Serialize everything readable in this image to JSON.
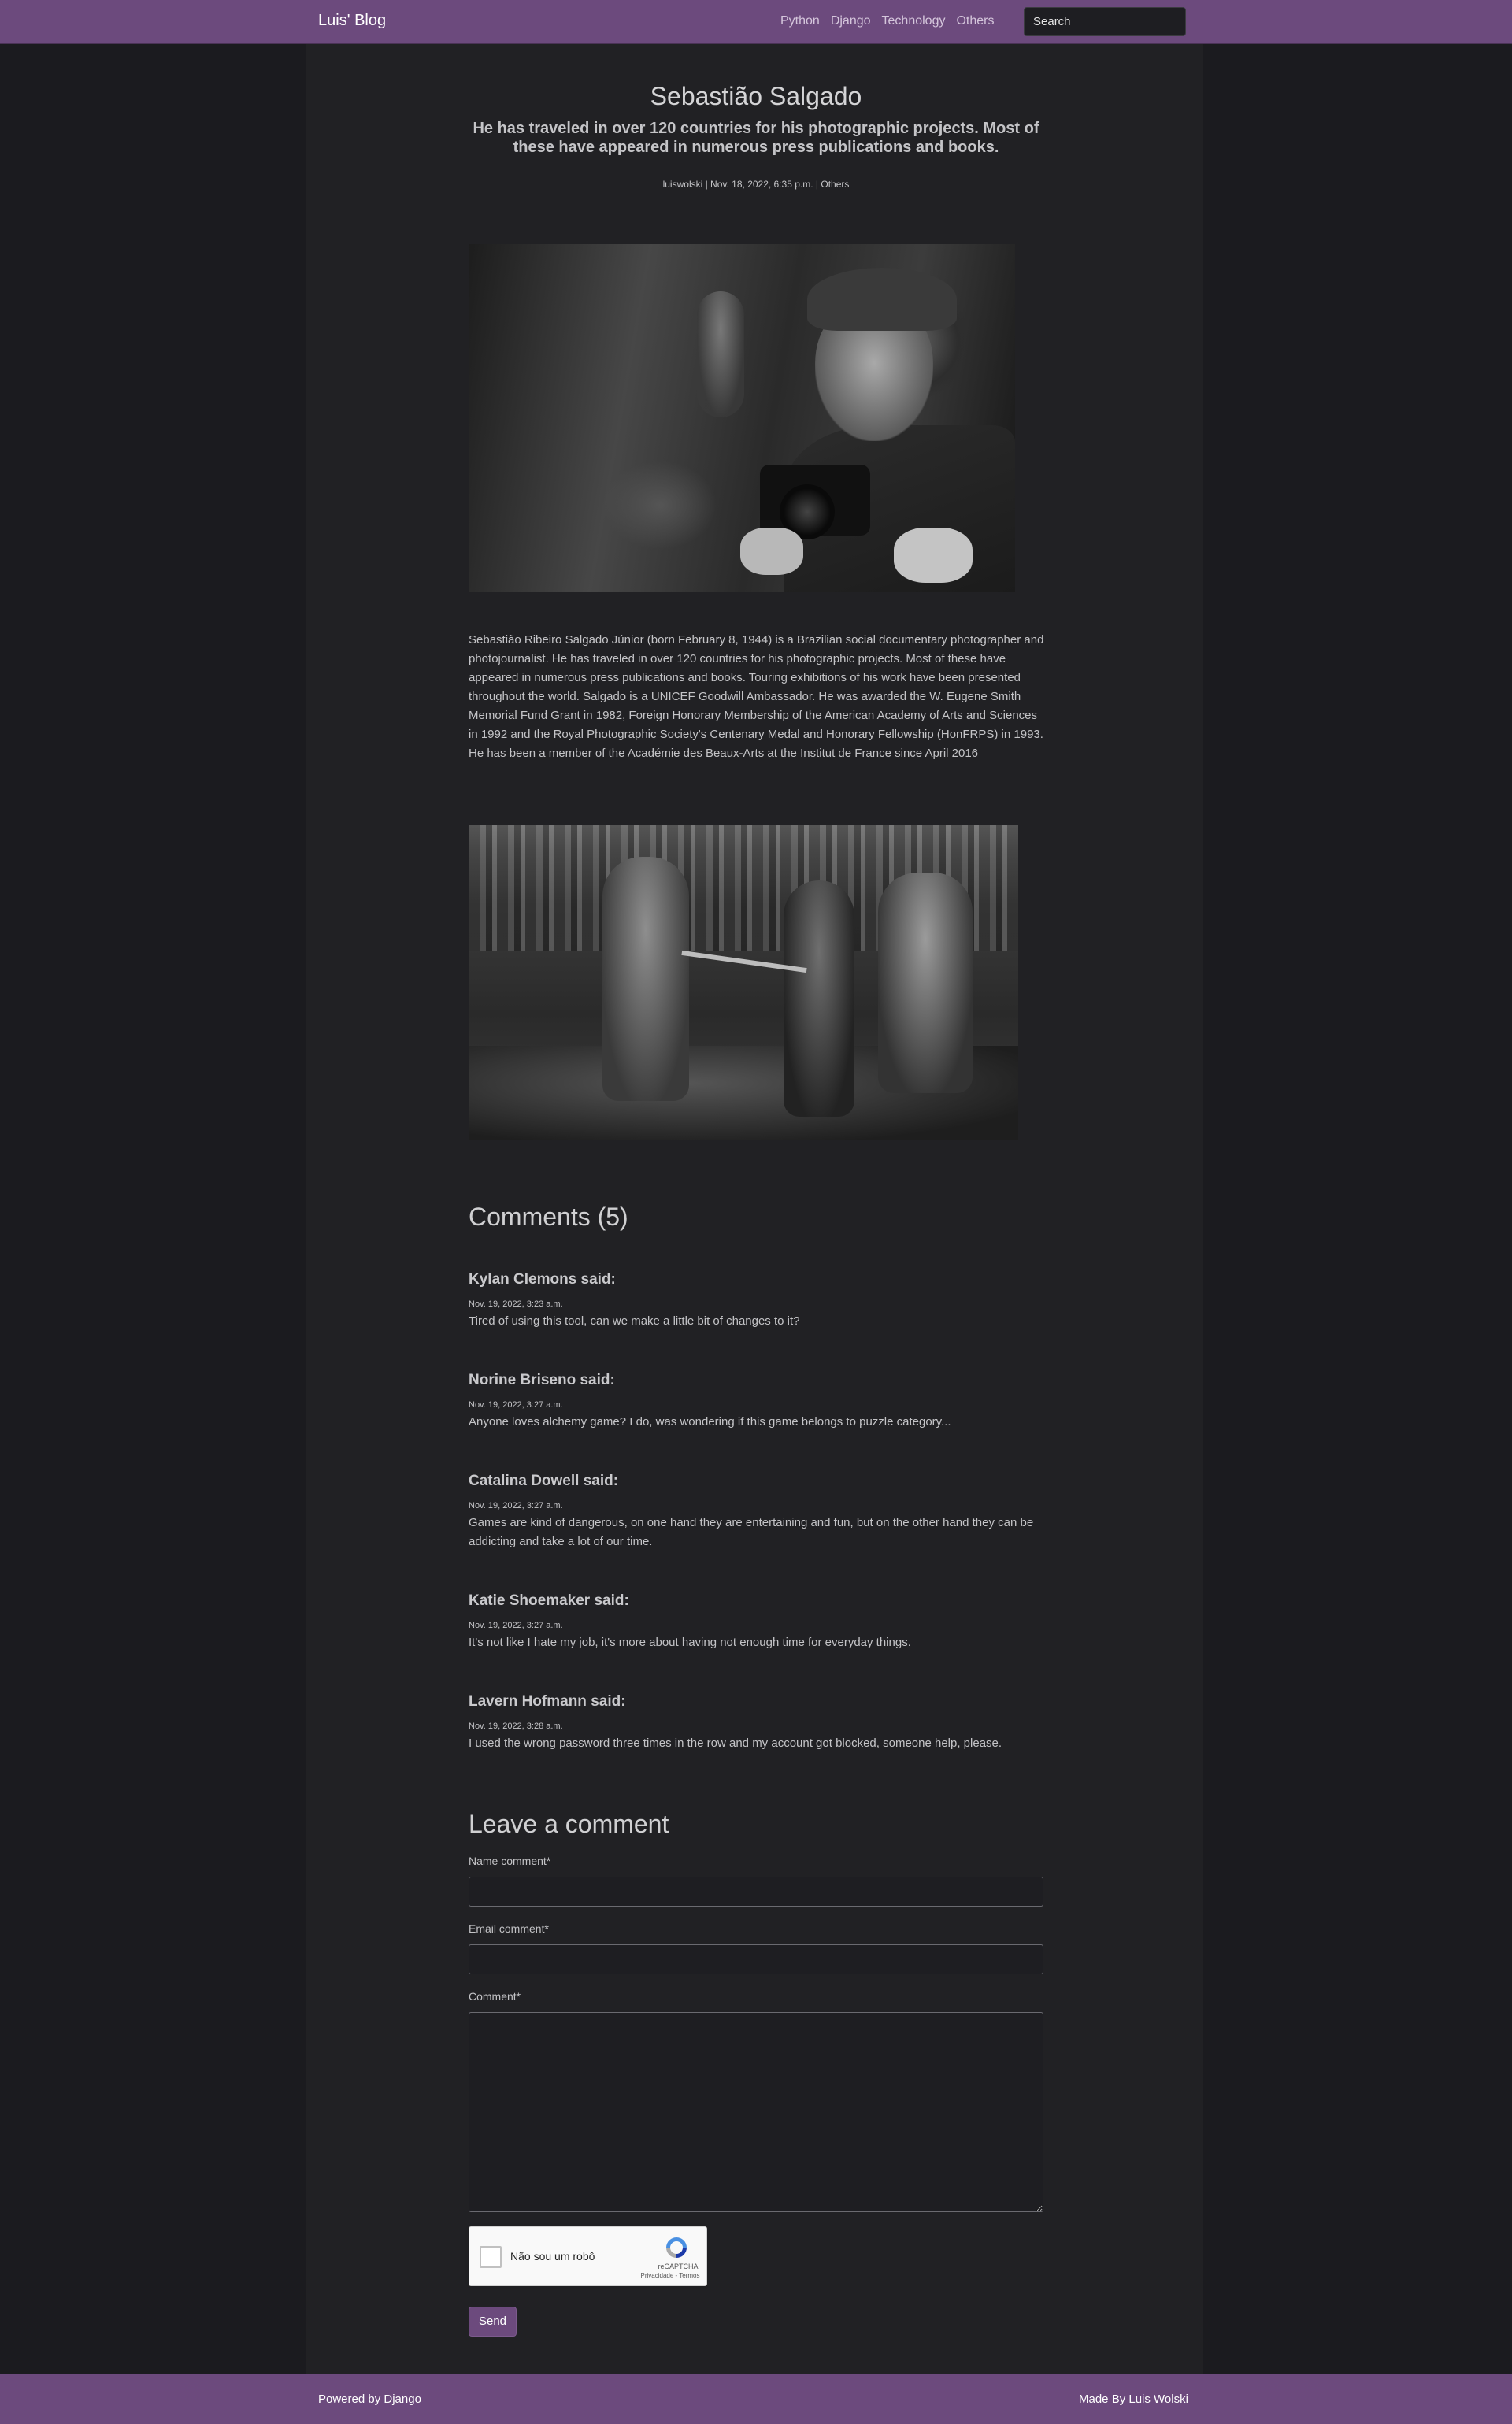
{
  "navbar": {
    "brand": "Luis' Blog",
    "links": [
      "Python",
      "Django",
      "Technology",
      "Others"
    ],
    "search_placeholder": "Search"
  },
  "post": {
    "title": "Sebastião Salgado",
    "subtitle": "He has traveled in over 120 countries for his photographic projects. Most of these have appeared in numerous press publications and books.",
    "meta": "luiswolski | Nov. 18, 2022, 6:35 p.m. | Others",
    "body": "Sebastião Ribeiro Salgado Júnior (born February 8, 1944) is a Brazilian social documentary photographer and photojournalist. He has traveled in over 120 countries for his photographic projects. Most of these have appeared in numerous press publications and books. Touring exhibitions of his work have been presented throughout the world. Salgado is a UNICEF Goodwill Ambassador. He was awarded the W. Eugene Smith Memorial Fund Grant in 1982, Foreign Honorary Membership of the American Academy of Arts and Sciences in 1992 and the Royal Photographic Society's Centenary Medal and Honorary Fellowship (HonFRPS) in 1993. He has been a member of the Académie des Beaux-Arts at the Institut de France since April 2016"
  },
  "comments": {
    "title": "Comments (5)",
    "items": [
      {
        "author": "Kylan Clemons said:",
        "date": "Nov. 19, 2022, 3:23 a.m.",
        "text": "Tired of using this tool, can we make a little bit of changes to it?"
      },
      {
        "author": "Norine Briseno said:",
        "date": "Nov. 19, 2022, 3:27 a.m.",
        "text": "Anyone loves alchemy game? I do, was wondering if this game belongs to puzzle category..."
      },
      {
        "author": "Catalina Dowell said:",
        "date": "Nov. 19, 2022, 3:27 a.m.",
        "text": "Games are kind of dangerous, on one hand they are entertaining and fun, but on the other hand they can be addicting and take a lot of our time."
      },
      {
        "author": "Katie Shoemaker said:",
        "date": "Nov. 19, 2022, 3:27 a.m.",
        "text": "It's not like I hate my job, it's more about having not enough time for everyday things."
      },
      {
        "author": "Lavern Hofmann said:",
        "date": "Nov. 19, 2022, 3:28 a.m.",
        "text": "I used the wrong password three times in the row and my account got blocked, someone help, please."
      }
    ]
  },
  "form": {
    "title": "Leave a comment",
    "name_label": "Name comment*",
    "email_label": "Email comment*",
    "comment_label": "Comment*",
    "recaptcha_label": "Não sou um robô",
    "recaptcha_brand": "reCAPTCHA",
    "recaptcha_terms": "Privacidade - Termos",
    "send_label": "Send"
  },
  "footer": {
    "left": "Powered by Django",
    "right": "Made By Luis Wolski"
  },
  "colors": {
    "accent": "#6c4a7d",
    "background": "#1b1b1f",
    "panel": "#212124"
  }
}
